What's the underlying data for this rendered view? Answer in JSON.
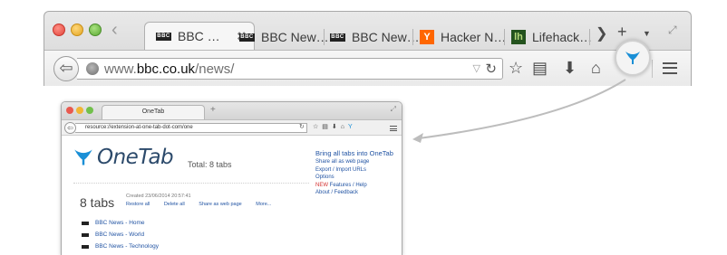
{
  "big_browser": {
    "tabs": [
      {
        "label": "BBC …",
        "favicon": "bbc-favicon",
        "active": true
      },
      {
        "label": "BBC New…",
        "favicon": "bbc-favicon",
        "active": false
      },
      {
        "label": "BBC New…",
        "favicon": "bbc-favicon",
        "active": false
      },
      {
        "label": "Hacker N…",
        "favicon": "hacker-news-favicon",
        "active": false
      },
      {
        "label": "Lifehack…",
        "favicon": "lifehacker-favicon",
        "active": false
      }
    ],
    "favicon_bbc_text": "BBC",
    "favicon_hn_text": "Y",
    "favicon_lh_text": "lh",
    "url_prefix": "www.",
    "url_domain": "bbc.co.uk",
    "url_path": "/news/",
    "colors": {
      "onetab_icon": "#1a8fd6",
      "hn_orange": "#ff6600",
      "lifehacker_green": "#24531e"
    }
  },
  "small_browser": {
    "tab_title": "OneTab",
    "url": "resource://extension-at-one-tab-dot-com/one",
    "logo_text": "OneTab",
    "total_text": "Total: 8 tabs",
    "side_links": {
      "main": "Bring all tabs into OneTab",
      "share": "Share all as web page",
      "export": "Export / Import URLs",
      "options": "Options",
      "new_tag": "NEW",
      "features": " Features / Help",
      "about": "About / Feedback"
    },
    "group": {
      "count_text": "8 tabs",
      "created_text": "Created 23/06/2014 20:57:41",
      "actions": [
        "Restore all",
        "Delete all",
        "Share as web page",
        "More..."
      ],
      "tabs": [
        "BBC News - Home",
        "BBC News - World",
        "BBC News - Technology"
      ]
    }
  }
}
